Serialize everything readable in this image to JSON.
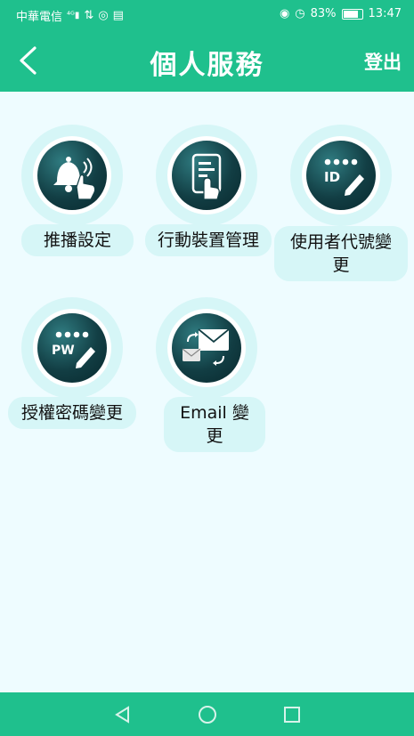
{
  "status_bar": {
    "carrier": "中華電信",
    "battery": "83%",
    "time": "13:47"
  },
  "app_bar": {
    "title": "個人服務",
    "logout_label": "登出"
  },
  "menu": [
    {
      "label": "推播設定",
      "icon": "bell-notification-icon"
    },
    {
      "label": "行動裝置管理",
      "icon": "mobile-device-icon"
    },
    {
      "label": "使用者代號變更",
      "icon": "id-edit-icon"
    },
    {
      "label": "授權密碼變更",
      "icon": "pw-edit-icon"
    },
    {
      "label": "Email 變更",
      "icon": "email-change-icon"
    }
  ],
  "colors": {
    "primary": "#1fc08d",
    "background": "#eefcff",
    "halo": "#d6f6f7",
    "icon_dark": "#123e44"
  }
}
